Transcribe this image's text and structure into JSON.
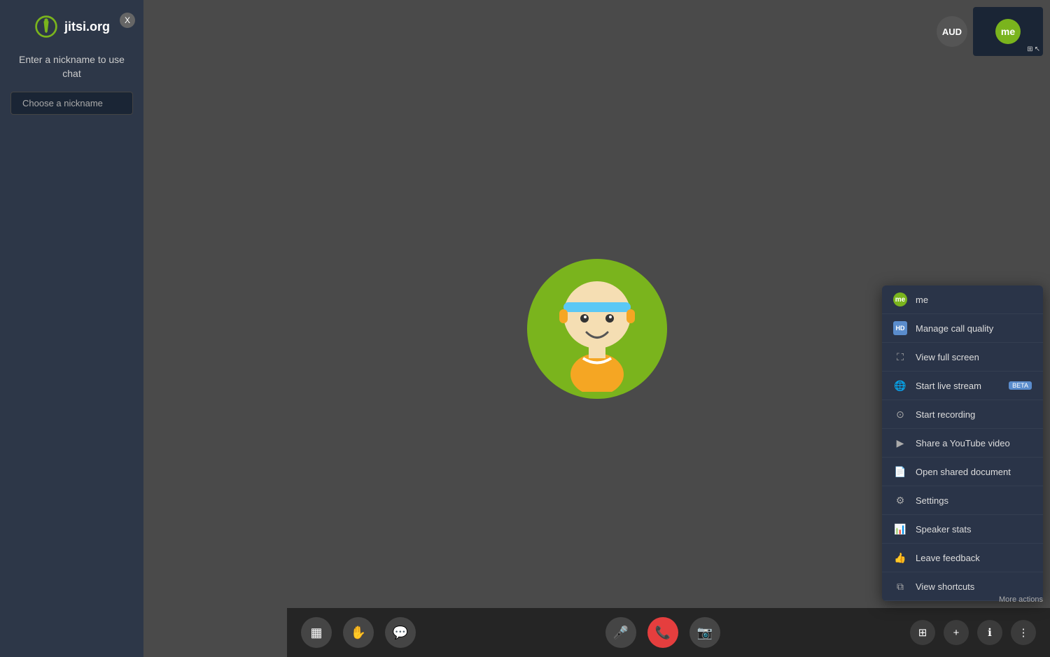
{
  "sidebar": {
    "logo_text": "jitsi.org",
    "close_label": "X",
    "chat_prompt": "Enter a nickname to use chat",
    "nickname_placeholder": "Choose a nickname"
  },
  "top_right": {
    "aud_label": "AUD",
    "me_label": "me"
  },
  "bottom_bar": {
    "tile_icon": "▦",
    "hand_icon": "✋",
    "chat_icon": "💬",
    "mute_icon": "🎤",
    "end_call_icon": "📞",
    "video_off_icon": "📷",
    "apps_icon": "⊞",
    "plus_icon": "+",
    "info_icon": "ℹ",
    "more_icon": "⋮"
  },
  "context_menu": {
    "items": [
      {
        "id": "me",
        "icon": "me",
        "icon_type": "green_dot",
        "label": "me"
      },
      {
        "id": "manage-call-quality",
        "icon": "HD",
        "icon_type": "hd",
        "label": "Manage call quality"
      },
      {
        "id": "view-full-screen",
        "icon": "⛶",
        "icon_type": "plain",
        "label": "View full screen"
      },
      {
        "id": "start-live-stream",
        "icon": "🌐",
        "icon_type": "plain",
        "label": "Start live stream",
        "badge": "BETA"
      },
      {
        "id": "start-recording",
        "icon": "⊙",
        "icon_type": "plain",
        "label": "Start recording"
      },
      {
        "id": "share-youtube",
        "icon": "▶",
        "icon_type": "plain",
        "label": "Share a YouTube video"
      },
      {
        "id": "open-shared-doc",
        "icon": "📄",
        "icon_type": "plain",
        "label": "Open shared document"
      },
      {
        "id": "settings",
        "icon": "⚙",
        "icon_type": "plain",
        "label": "Settings"
      },
      {
        "id": "speaker-stats",
        "icon": "📊",
        "icon_type": "plain",
        "label": "Speaker stats"
      },
      {
        "id": "leave-feedback",
        "icon": "👍",
        "icon_type": "plain",
        "label": "Leave feedback"
      },
      {
        "id": "view-shortcuts",
        "icon": "⧉",
        "icon_type": "plain",
        "label": "View shortcuts"
      }
    ],
    "more_actions_label": "More actions"
  }
}
